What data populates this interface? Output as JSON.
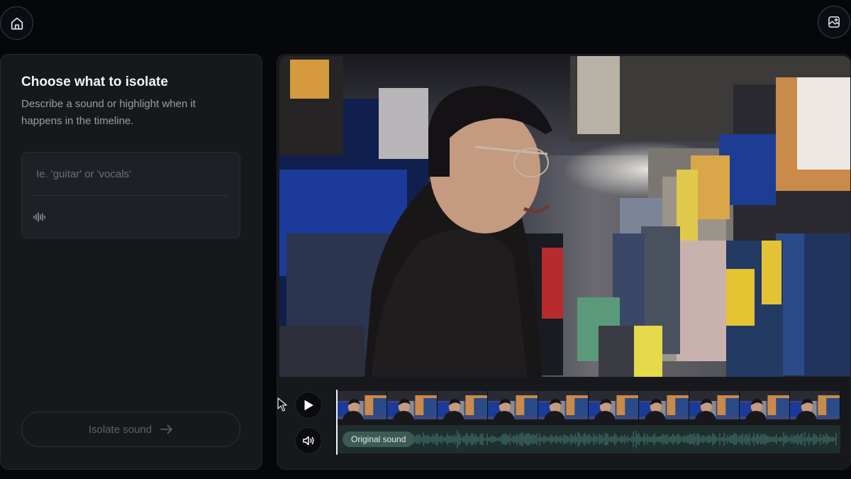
{
  "topbar": {
    "home_icon": "home-icon",
    "gallery_icon": "gallery-icon"
  },
  "left_panel": {
    "title": "Choose what to isolate",
    "description": "Describe a sound or highlight when it happens in the timeline.",
    "prompt_placeholder": "Ie. 'guitar' or 'vocals'",
    "prompt_value": "",
    "waveform_icon": "waveform-icon",
    "isolate_button_label": "Isolate sound",
    "isolate_button_icon": "arrow-right-icon"
  },
  "player": {
    "play_icon": "play-icon",
    "volume_icon": "volume-icon",
    "audio_track_label": "Original sound",
    "filmstrip_frames": 10,
    "playhead_position": 0
  },
  "colors": {
    "background": "#06070b",
    "panel": "#17181c",
    "audio_track": "#1f2f2e",
    "audio_waveform": "#3e6b64",
    "audio_label_bg": "#3d5a55"
  }
}
